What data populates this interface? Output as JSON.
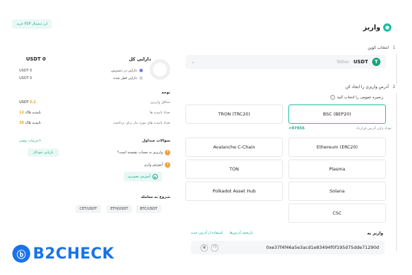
{
  "header": {
    "title": "واریز",
    "p2p_button": "خرید P2P ارز دیجیتال"
  },
  "steps": {
    "step1": {
      "num": "1",
      "label": "انتخاب کوین"
    },
    "step2": {
      "num": "2",
      "label": "آدرس واریزی را ایجاد کن"
    }
  },
  "coin_select": {
    "symbol": "USDT",
    "name": "Tether",
    "icon": "T"
  },
  "network_section": {
    "label": "زنجیره عمومی را انتخاب کنید",
    "networks": [
      {
        "label": "BSC (BEP20)",
        "selected": true
      },
      {
        "label": "TRON (TRC20)",
        "selected": false
      },
      {
        "label": "Ethereum (ERC20)",
        "selected": false
      },
      {
        "label": "Avalanche C-Chain",
        "selected": false
      },
      {
        "label": "Plasma",
        "selected": false
      },
      {
        "label": "TON",
        "selected": false
      },
      {
        "label": "Solana",
        "selected": false
      },
      {
        "label": "Polkadot Asset Hub",
        "selected": false
      },
      {
        "label": "CSC",
        "selected": false
      }
    ],
    "hint": "تعداد پایان آدرس قرارداد",
    "contract_suffix": "<97955"
  },
  "deposit": {
    "label": "واریز به",
    "link_history": "تاریخچه آدرس‌ها",
    "link_new": "استفاده از آدرس جدید",
    "address": "0xe37f4f46a5e3acd1e83494f0f195d75dde71290d"
  },
  "assets": {
    "title": "دارایی کل",
    "total": "USDT 0",
    "available_label": "دارایی در دسترس",
    "available_value": "USDT 0",
    "frozen_label": "دارایی قفل شده",
    "frozen_value": "USDT 0",
    "colors": {
      "available": "#6c7cf0",
      "frozen": "#cfd3d8"
    }
  },
  "notes": {
    "title": "توجه",
    "min_label": "حداقل واریزی",
    "min_value": "0.2",
    "min_unit": "USDT",
    "conf_label": "تعداد تاییدیه ها",
    "conf_value": "12",
    "conf_unit": "تاییدیه بلاک",
    "withdraw_conf_label": "تعداد تاییدیه های مورد نیاز برای برداشت",
    "withdraw_conf_value": "30",
    "withdraw_conf_unit": "تاییدیه بلاک"
  },
  "faq": {
    "title": "سوالات متداول",
    "more": "جزییات بیشتر>",
    "q1": "واریزی به حساب نشسته است؟",
    "q1_button": "بازیابی خودکار",
    "q2": "آموزش واریز",
    "video_button": "آموزش تصویری"
  },
  "trade": {
    "title": "شروع به معامله",
    "pairs": [
      "BTC/USDT",
      "ETH/USDT",
      "CET/USDT"
    ]
  },
  "watermark": {
    "text": "B2CHECK"
  }
}
